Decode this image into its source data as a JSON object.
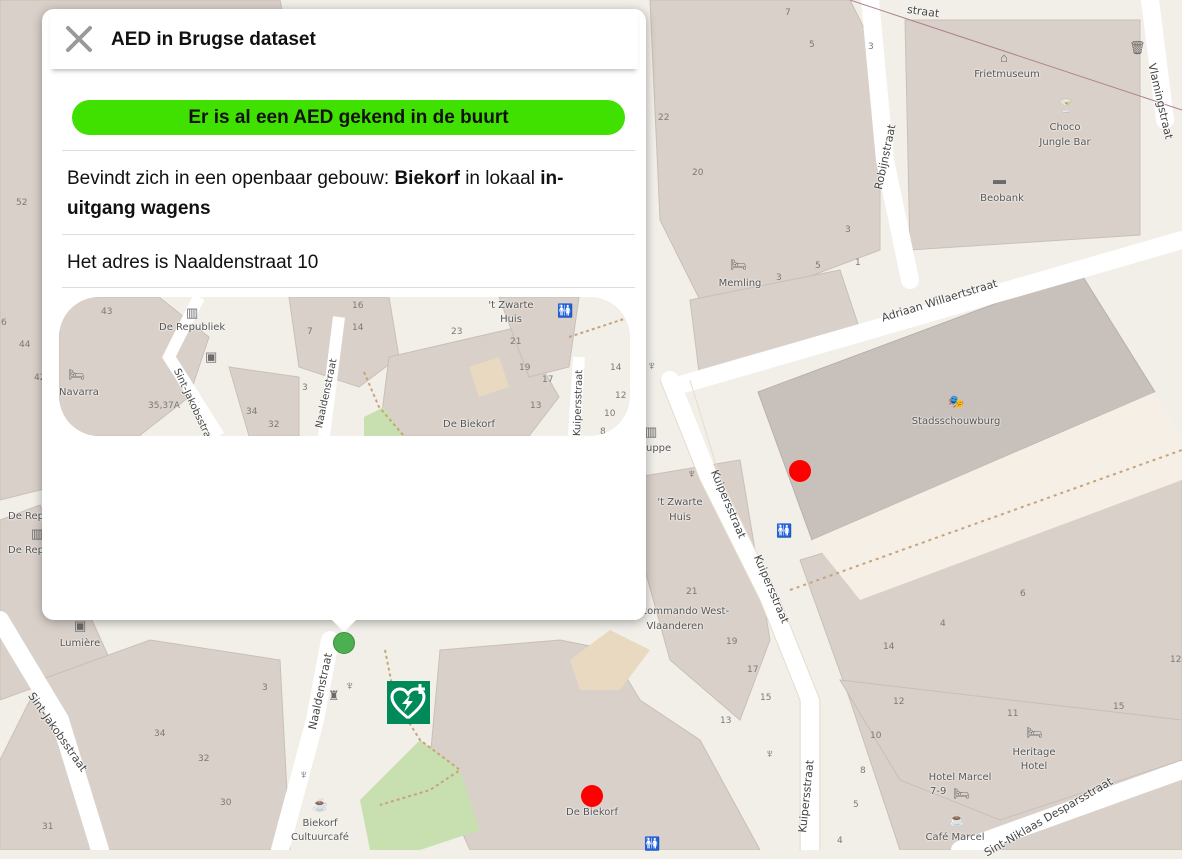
{
  "popup": {
    "title": "AED in Brugse dataset",
    "status": "Er is al een AED gekend in de buurt",
    "location_prefix": "Bevindt zich in een openbaar gebouw: ",
    "building": "Biekorf",
    "location_mid": " in lokaal ",
    "room": "in-uitgang wagens",
    "address": "Het adres is Naaldenstraat 10",
    "colors": {
      "status_bg": "#40e000"
    }
  },
  "minimap": {
    "labels": [
      "De Republiek",
      "Navarra",
      "'t Zwarte Huis",
      "De Biekorf",
      "Sint-Jakobsstraat",
      "Naaldenstraat",
      "Kuipersstraat"
    ],
    "numbers": [
      "43",
      "16",
      "14",
      "7",
      "23",
      "21",
      "19",
      "17",
      "13",
      "10",
      "12",
      "14",
      "8",
      "3",
      "34",
      "32",
      "35,37A"
    ]
  },
  "map": {
    "streets": [
      "Adriaan Willaertstraat",
      "Kuipersstraat",
      "Kuipersstraat",
      "Naaldenstraat",
      "Sint-Jakobsstraat",
      "Robijnstraat",
      "Vlamingstraat",
      "Sint-Niklaas Desparsstraat",
      "Kuipersstraat",
      "straat"
    ],
    "places": [
      "Frietmuseum",
      "Choco Jungle Bar",
      "Beobank",
      "Memling",
      "Stadsschouwburg",
      "'t Zwarte Huis",
      "nciecommando West-Vlaanderen",
      "Lumière",
      "Biekorf Cultuurcafé",
      "De Biekorf",
      "Hotel Marcel",
      "7-9",
      "Heritage Hotel",
      "Café Marcel",
      "De Rep",
      "De Rep",
      "uppe"
    ],
    "house_numbers": [
      "7",
      "5",
      "3",
      "22",
      "20",
      "3",
      "5",
      "1",
      "3",
      "52",
      "6",
      "44",
      "42",
      "21",
      "19",
      "17",
      "15",
      "13",
      "10",
      "8",
      "5",
      "4",
      "14",
      "12",
      "11",
      "15",
      "6",
      "4",
      "12",
      "3",
      "34",
      "32",
      "30",
      "31"
    ],
    "markers": {
      "aed_red": 2,
      "aed_green": 1,
      "aed_icon": "aed-defibrillator-icon"
    },
    "colors": {
      "red_marker": "#ff0000",
      "green_marker": "#4caf50",
      "aed_icon_bg": "#008a5a"
    }
  }
}
